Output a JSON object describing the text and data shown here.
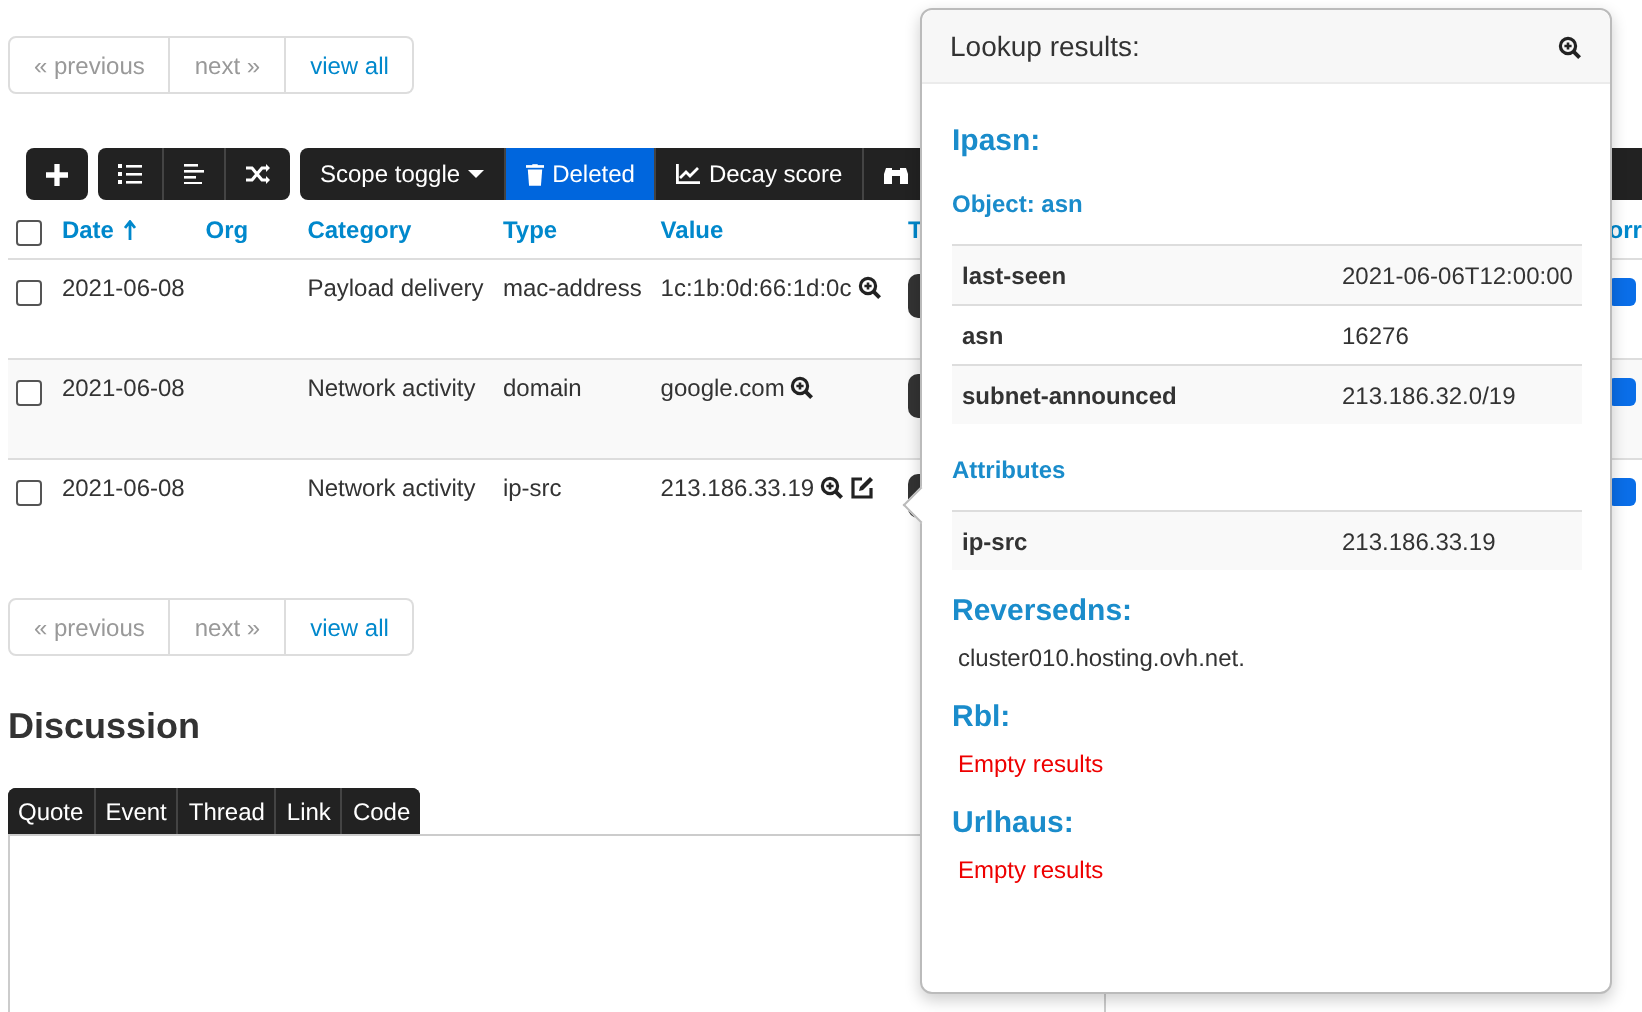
{
  "pagination_top": [
    {
      "label": "« previous",
      "disabled": true
    },
    {
      "label": "next »",
      "disabled": true
    },
    {
      "label": "view all",
      "disabled": false
    }
  ],
  "toolbar": {
    "scope_toggle": "Scope toggle",
    "buttons": [
      {
        "label": "Deleted",
        "active": true
      },
      {
        "label": "Decay score",
        "active": false
      }
    ]
  },
  "table": {
    "columns": [
      {
        "label": "Date",
        "sorted": true
      },
      {
        "label": "Org"
      },
      {
        "label": "Category"
      },
      {
        "label": "Type"
      },
      {
        "label": "Value"
      },
      {
        "label": "T"
      },
      {
        "label": "orr"
      }
    ],
    "header_checked": false,
    "rows": [
      {
        "checked": false,
        "date": "2021-06-08",
        "category": "Payload delivery",
        "type": "mac-address",
        "value": "1c:1b:0d:66:1d:0c",
        "editable": false
      },
      {
        "checked": false,
        "date": "2021-06-08",
        "category": "Network activity",
        "type": "domain",
        "value": "google.com",
        "editable": false
      },
      {
        "checked": false,
        "date": "2021-06-08",
        "category": "Network activity",
        "type": "ip-src",
        "value": "213.186.33.19",
        "editable": true
      }
    ]
  },
  "pagination_bottom": [
    {
      "label": "« previous",
      "disabled": true
    },
    {
      "label": "next »",
      "disabled": true
    },
    {
      "label": "view all",
      "disabled": false
    }
  ],
  "discussion": {
    "title": "Discussion",
    "buttons": [
      "Quote",
      "Event",
      "Thread",
      "Link",
      "Code"
    ]
  },
  "popover": {
    "title": "Lookup results:",
    "blocks": [
      {
        "kind": "heading",
        "text": "Ipasn:"
      },
      {
        "kind": "subheading",
        "text": "Object: asn"
      },
      {
        "kind": "table",
        "rows": [
          {
            "key": "last-seen",
            "value": "2021-06-06T12:00:00"
          },
          {
            "key": "asn",
            "value": "16276"
          },
          {
            "key": "subnet-announced",
            "value": "213.186.32.0/19"
          }
        ]
      },
      {
        "kind": "subheading",
        "text": "Attributes"
      },
      {
        "kind": "table",
        "rows": [
          {
            "key": "ip-src",
            "value": "213.186.33.19"
          }
        ]
      },
      {
        "kind": "heading",
        "text": "Reversedns:"
      },
      {
        "kind": "text",
        "text": "cluster010.hosting.ovh.net."
      },
      {
        "kind": "heading",
        "text": "Rbl:"
      },
      {
        "kind": "empty",
        "text": "Empty results"
      },
      {
        "kind": "heading",
        "text": "Urlhaus:"
      },
      {
        "kind": "empty",
        "text": "Empty results"
      }
    ]
  }
}
